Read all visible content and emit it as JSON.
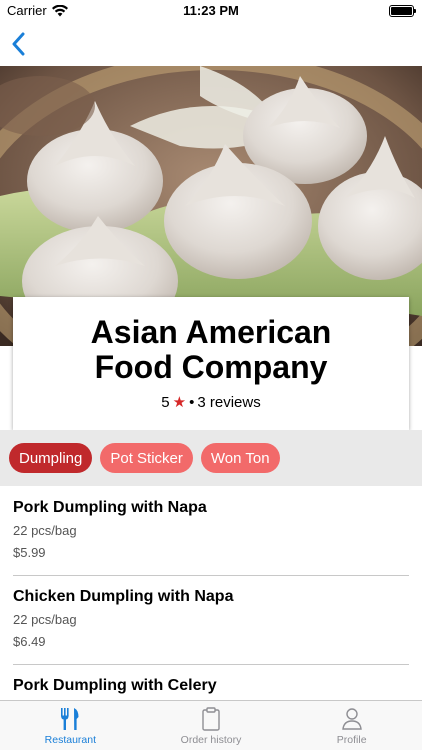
{
  "status_bar": {
    "carrier": "Carrier",
    "time": "11:23 PM"
  },
  "nav": {
    "back_icon": "chevron-left-icon"
  },
  "restaurant": {
    "name": "Asian American Food Company",
    "rating": "5",
    "reviews": "3 reviews",
    "separator": "•"
  },
  "categories": [
    {
      "label": "Dumpling",
      "active": true
    },
    {
      "label": "Pot Sticker",
      "active": false
    },
    {
      "label": "Won Ton",
      "active": false
    }
  ],
  "menu_items": [
    {
      "name": "Pork Dumpling with Napa",
      "quantity": "22 pcs/bag",
      "price": "$5.99"
    },
    {
      "name": "Chicken Dumpling with Napa",
      "quantity": "22 pcs/bag",
      "price": "$6.49"
    },
    {
      "name": "Pork Dumpling with Celery",
      "quantity": "",
      "price": ""
    }
  ],
  "tab_bar": {
    "tabs": [
      {
        "label": "Restaurant",
        "icon": "fork-knife-icon",
        "active": true
      },
      {
        "label": "Order history",
        "icon": "clipboard-icon",
        "active": false
      },
      {
        "label": "Profile",
        "icon": "person-icon",
        "active": false
      }
    ]
  },
  "colors": {
    "accent_blue": "#1a7fd8",
    "chip_active": "#c0292c",
    "chip_inactive": "#f26a6a",
    "star_red": "#d62828"
  }
}
